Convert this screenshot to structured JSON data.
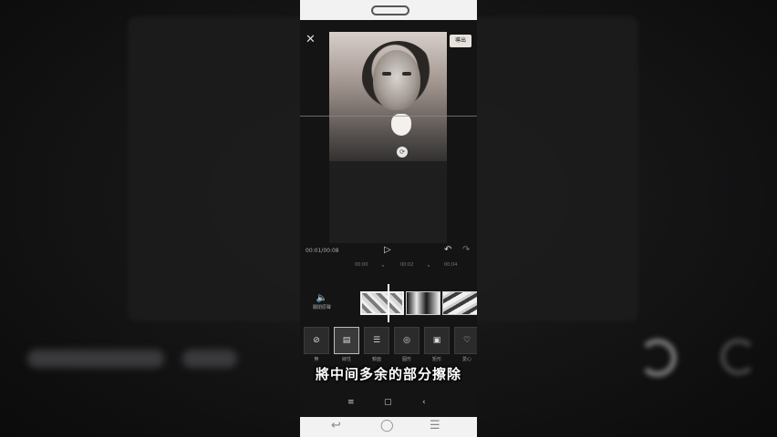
{
  "editor": {
    "close_glyph": "✕",
    "export_label": "導出",
    "time_display": "00:01/00:08",
    "play_glyph": "▷",
    "undo_glyph": "↶",
    "redo_glyph": "↷",
    "rotate_glyph": "⟳"
  },
  "ruler": {
    "ticks": [
      "00:00",
      "00:02",
      "00:04"
    ]
  },
  "track": {
    "mute_glyph": "🔈",
    "mute_label": "關閉原聲"
  },
  "toolbar": {
    "tools": [
      {
        "icon": "⊘",
        "label": "無"
      },
      {
        "icon": "▤",
        "label": "線性"
      },
      {
        "icon": "☰",
        "label": "鏡面"
      },
      {
        "icon": "◎",
        "label": "圓形"
      },
      {
        "icon": "▣",
        "label": "矩形"
      },
      {
        "icon": "♡",
        "label": "愛心"
      }
    ]
  },
  "caption": "將中间多余的部分擦除",
  "system_nav": {
    "menu": "≡",
    "home": "▢",
    "back": "‹"
  },
  "phone_bar": {
    "back": "↩",
    "home": "◯",
    "menu": "☰"
  }
}
